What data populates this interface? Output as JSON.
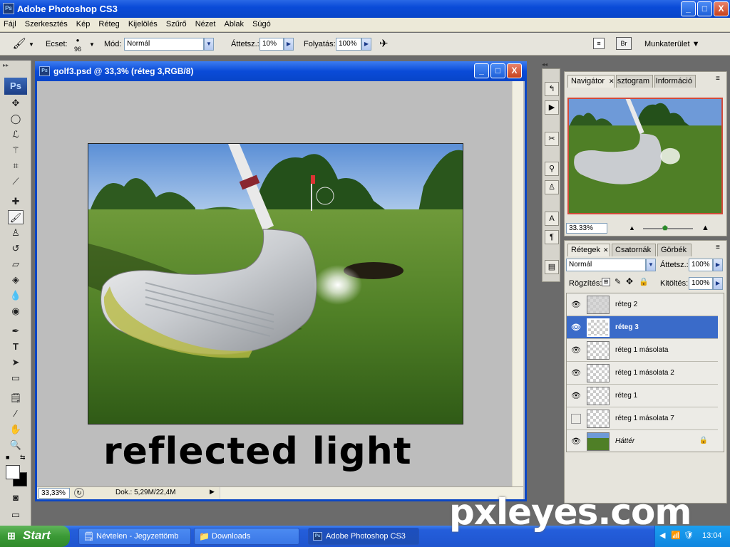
{
  "app": {
    "title": "Adobe Photoshop CS3",
    "icon_text": "Ps"
  },
  "window_buttons": {
    "minimize": "_",
    "maximize": "□",
    "close": "X"
  },
  "menu": [
    "Fájl",
    "Szerkesztés",
    "Kép",
    "Réteg",
    "Kijelölés",
    "Szűrő",
    "Nézet",
    "Ablak",
    "Súgó"
  ],
  "options": {
    "brush_label": "Ecset:",
    "brush_size": "96",
    "mode_label": "Mód:",
    "mode_value": "Normál",
    "opacity_label": "Áttetsz.:",
    "opacity_value": "10%",
    "flow_label": "Folyatás:",
    "flow_value": "100%",
    "workspace_label": "Munkaterület ▼"
  },
  "toolbox": {
    "logo": "Ps",
    "tools": [
      "move-tool",
      "marquee-tool",
      "lasso-tool",
      "magic-wand-tool",
      "crop-tool",
      "slice-tool",
      "healing-tool",
      "brush-tool",
      "clone-stamp-tool",
      "history-brush-tool",
      "eraser-tool",
      "paint-bucket-tool",
      "blur-tool",
      "dodge-tool",
      "pen-tool",
      "type-tool",
      "path-select-tool",
      "shape-tool",
      "notes-tool",
      "eyedropper-tool",
      "hand-tool",
      "zoom-tool"
    ]
  },
  "document": {
    "title": "golf3.psd @ 33,3% (réteg 3,RGB/8)",
    "caption": "reflected light",
    "zoom": "33,33%",
    "doc_info": "Dok.: 5,29M/22,4M"
  },
  "navigator": {
    "tabs": [
      "Navigátor",
      "Hisztogram",
      "Információ"
    ],
    "zoom": "33.33%"
  },
  "layers_panel": {
    "tabs": [
      "Rétegek",
      "Csatornák",
      "Görbék"
    ],
    "blend_mode": "Normál",
    "opacity_label": "Áttetsz.:",
    "opacity_value": "100%",
    "lock_label": "Rögzítés:",
    "fill_label": "Kitöltés:",
    "fill_value": "100%",
    "layers": [
      {
        "name": "réteg 2",
        "visible": true,
        "selected": false
      },
      {
        "name": "réteg 3",
        "visible": true,
        "selected": true
      },
      {
        "name": "réteg 1 másolata",
        "visible": true,
        "selected": false
      },
      {
        "name": "réteg 1 másolata 2",
        "visible": true,
        "selected": false
      },
      {
        "name": "réteg 1",
        "visible": true,
        "selected": false
      },
      {
        "name": "réteg 1 másolata 7",
        "visible": false,
        "selected": false
      },
      {
        "name": "Háttér",
        "visible": true,
        "selected": false,
        "locked": true
      }
    ]
  },
  "taskbar": {
    "start": "Start",
    "items": [
      "Névtelen - Jegyzettömb",
      "Downloads",
      "Adobe Photoshop CS3"
    ],
    "time": "13:04"
  },
  "watermark": "pxleyes.com",
  "colors": {
    "xp_blue": "#0a4bd8",
    "selection": "#3a6bc9",
    "start_green": "#3b9a36"
  }
}
